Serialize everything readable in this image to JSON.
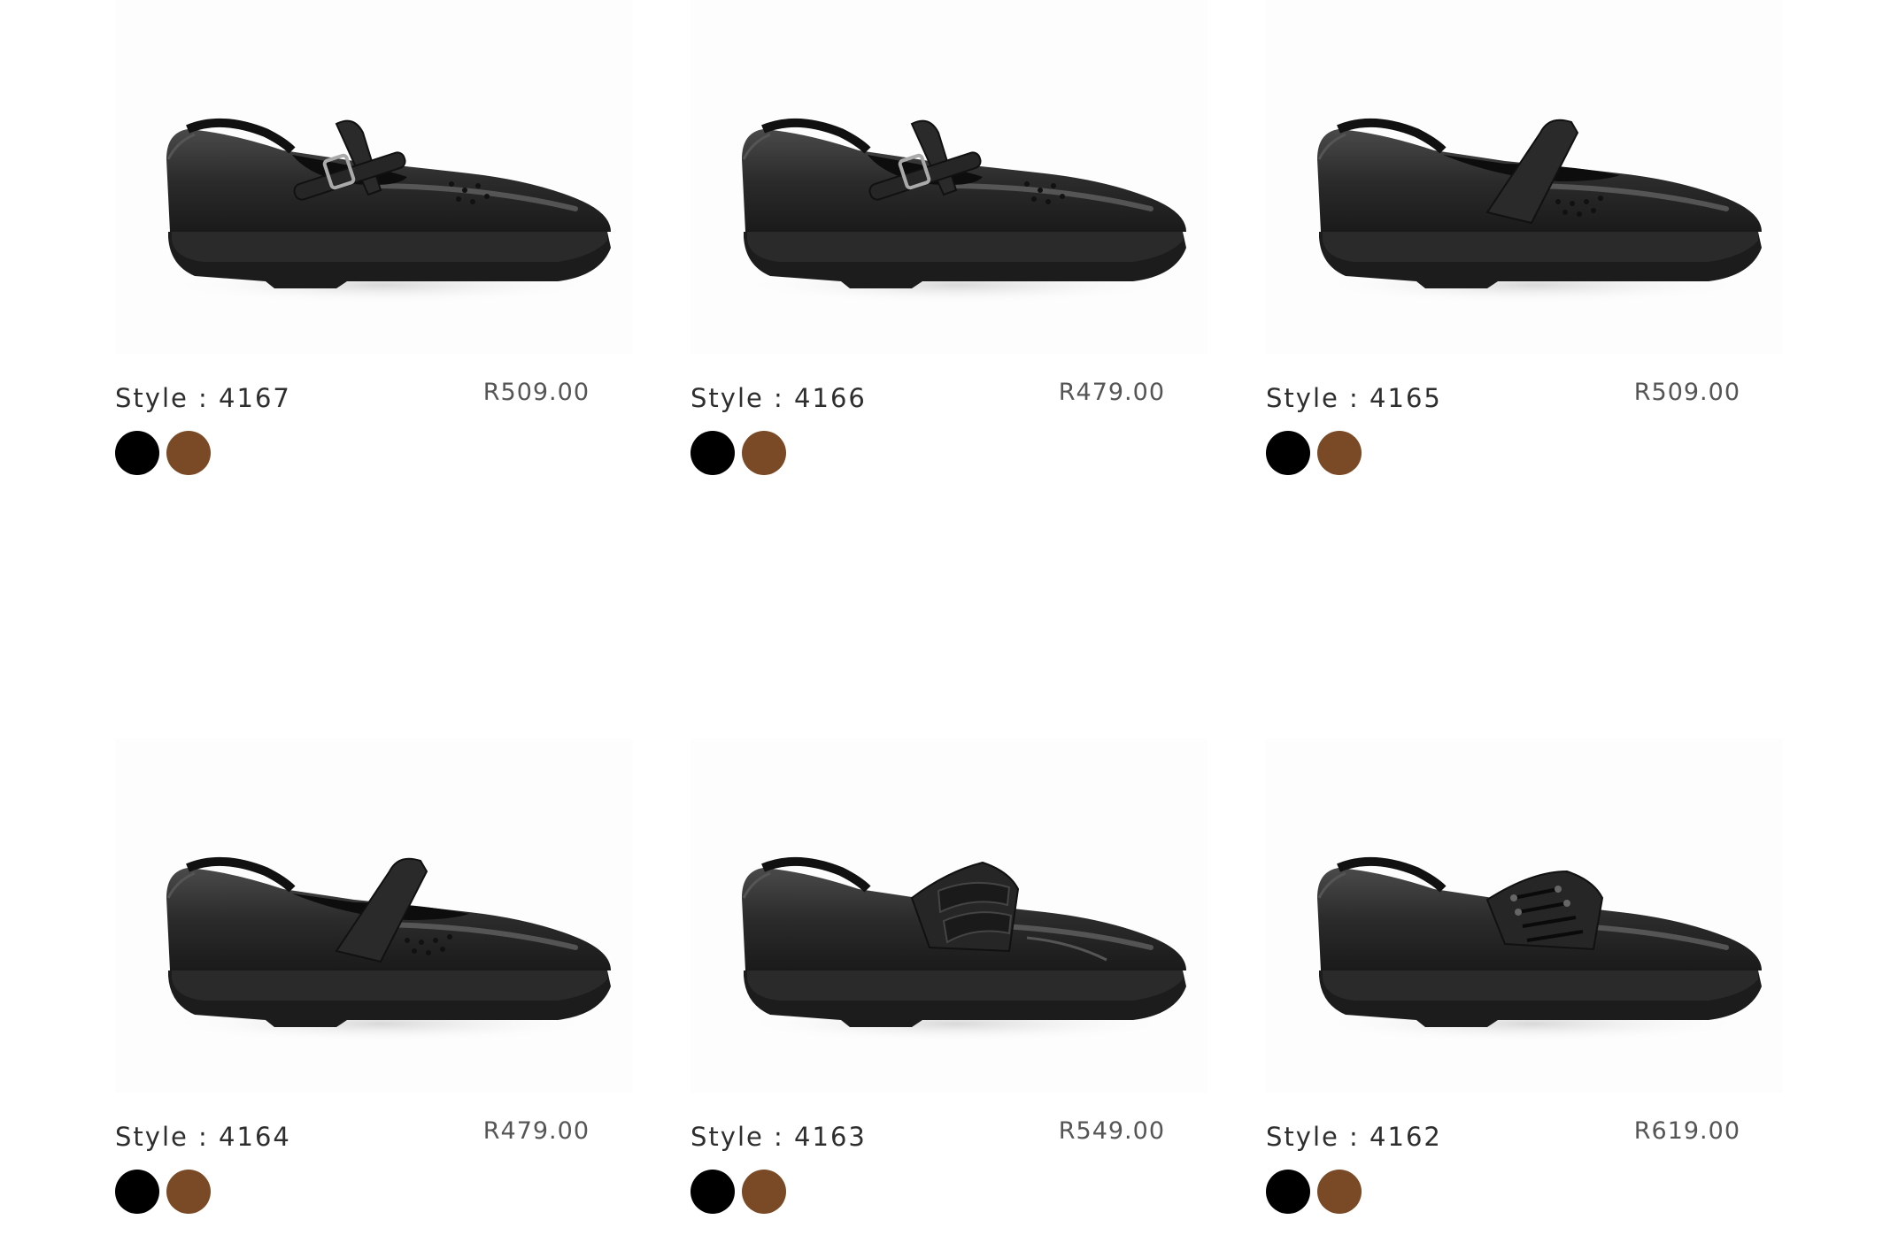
{
  "products": [
    {
      "style": "Style : 4167",
      "price": "R509.00",
      "variant": "t-bar",
      "swatches": [
        {
          "name": "black",
          "color": "#000000"
        },
        {
          "name": "brown",
          "color": "#7a4a26"
        }
      ]
    },
    {
      "style": "Style : 4166",
      "price": "R479.00",
      "variant": "t-bar",
      "swatches": [
        {
          "name": "black",
          "color": "#000000"
        },
        {
          "name": "brown",
          "color": "#7a4a26"
        }
      ]
    },
    {
      "style": "Style : 4165",
      "price": "R509.00",
      "variant": "mary-jane",
      "swatches": [
        {
          "name": "black",
          "color": "#000000"
        },
        {
          "name": "brown",
          "color": "#7a4a26"
        }
      ]
    },
    {
      "style": "Style : 4164",
      "price": "R479.00",
      "variant": "mary-jane",
      "swatches": [
        {
          "name": "black",
          "color": "#000000"
        },
        {
          "name": "brown",
          "color": "#7a4a26"
        }
      ]
    },
    {
      "style": "Style : 4163",
      "price": "R549.00",
      "variant": "velcro",
      "swatches": [
        {
          "name": "black",
          "color": "#000000"
        },
        {
          "name": "brown",
          "color": "#7a4a26"
        }
      ]
    },
    {
      "style": "Style : 4162",
      "price": "R619.00",
      "variant": "lace-up",
      "swatches": [
        {
          "name": "black",
          "color": "#000000"
        },
        {
          "name": "brown",
          "color": "#7a4a26"
        }
      ]
    }
  ]
}
